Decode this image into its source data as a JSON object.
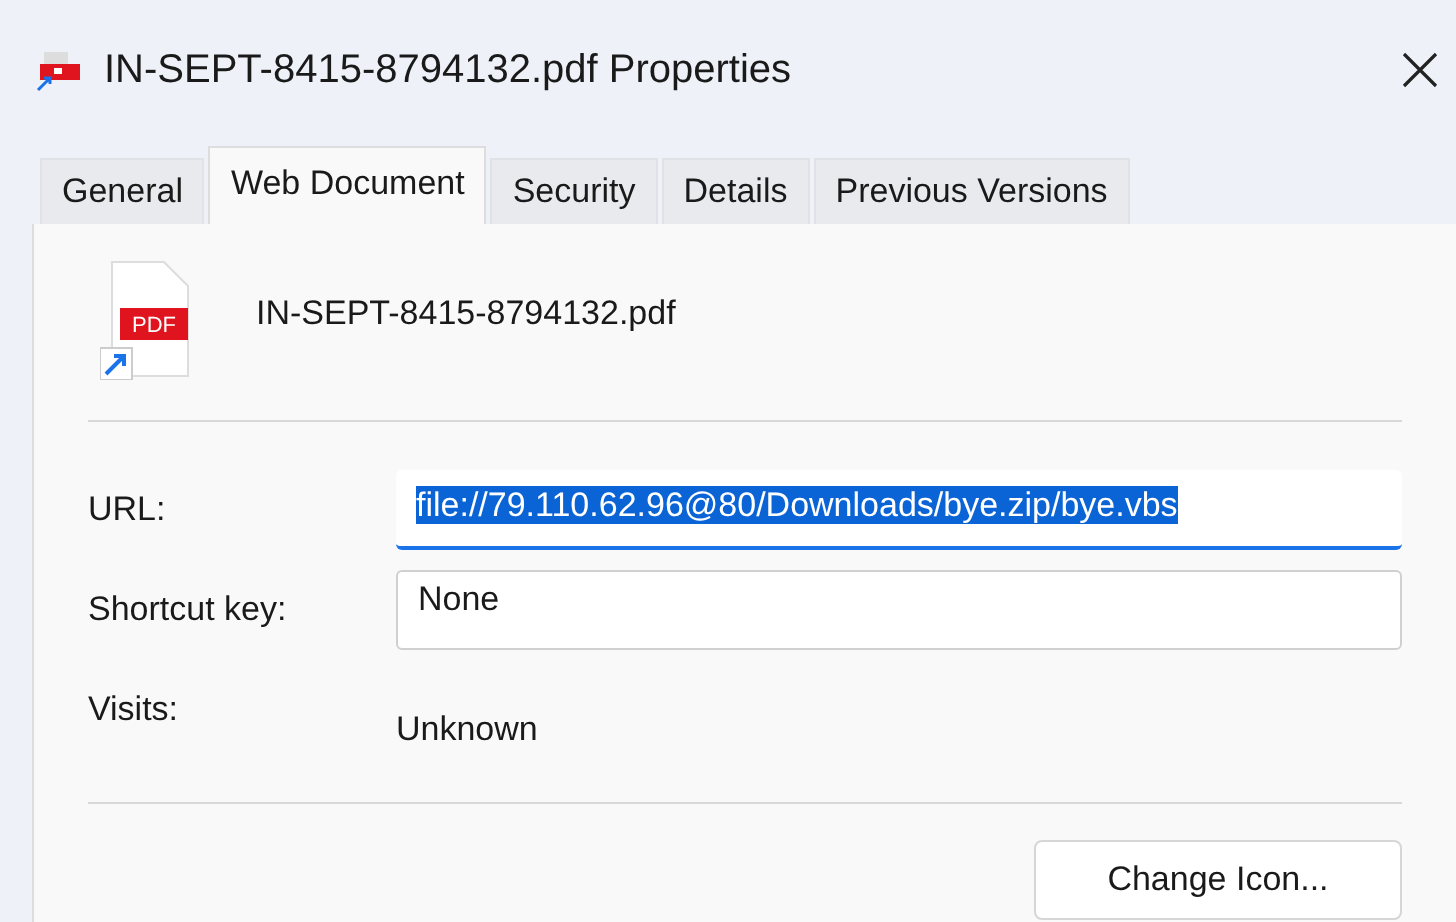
{
  "window": {
    "title": "IN-SEPT-8415-8794132.pdf Properties"
  },
  "tabs": [
    {
      "label": "General",
      "selected": false
    },
    {
      "label": "Web Document",
      "selected": true
    },
    {
      "label": "Security",
      "selected": false
    },
    {
      "label": "Details",
      "selected": false
    },
    {
      "label": "Previous Versions",
      "selected": false
    }
  ],
  "file": {
    "name": "IN-SEPT-8415-8794132.pdf",
    "icon_text": "PDF"
  },
  "fields": [
    {
      "label": "URL:",
      "kind": "input",
      "value": "file://79.110.62.96@80/Downloads/bye.zip/bye.vbs",
      "selected": true,
      "focused": true
    },
    {
      "label": "Shortcut key:",
      "kind": "input",
      "value": "None",
      "selected": false,
      "focused": false
    },
    {
      "label": "Visits:",
      "kind": "text",
      "value": "Unknown"
    }
  ],
  "buttons": [
    {
      "label": "Change Icon..."
    }
  ]
}
